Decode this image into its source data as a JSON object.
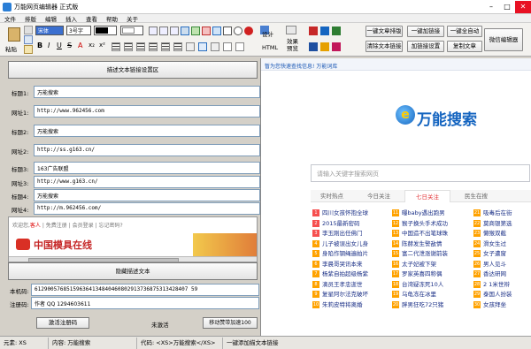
{
  "window": {
    "title": "万能网页编辑器 正式版"
  },
  "menu": [
    "文件",
    "排版",
    "编辑",
    "插入",
    "查看",
    "帮助",
    "关于"
  ],
  "toolbar": {
    "paste": "粘贴",
    "font": "宋体",
    "size": "3号字",
    "design": "设计",
    "html": "HTML",
    "preview_l1": "效果",
    "preview_l2": "预览",
    "cmds": [
      "一键文章排版",
      "一键加链接",
      "一键全自动",
      "清除文本链接",
      "加链接设置",
      "复制文章",
      "微信编辑器"
    ]
  },
  "left": {
    "header_btn": "描述文本链接设置区",
    "rows": [
      {
        "label": "标题1:",
        "value": "万能搜索"
      },
      {
        "label": "网址1:",
        "value": "http://www.962456.com"
      },
      {
        "label": "标题2:",
        "value": "万能搜索"
      },
      {
        "label": "网址2:",
        "value": "http://ss.g163.cn/"
      },
      {
        "label": "标题3:",
        "value": "163广告联盟"
      },
      {
        "label": "网址3:",
        "value": "http://www.g163.cn/"
      },
      {
        "label": "标题4:",
        "value": "万能搜索"
      },
      {
        "label": "网址4:",
        "value": "http://m.962456.com/"
      }
    ],
    "ad_welcome": "欢迎您,",
    "ad_guest": "客人",
    "ad_links": "| 免费注册 | 会员登录 | 忘记密码?",
    "ad_logo": "中国模具在线",
    "hide_btn": "隐藏描述文本",
    "machine_label": "本机码:",
    "machine_value": "612900576851596364134840460802913736875313428407 59",
    "reg_label": "注册码:",
    "reg_value": "作者 QQ 1294603611",
    "activate_btn": "激活注册码",
    "status": "未激活",
    "move_btn": "移动赞带加速100"
  },
  "preview": {
    "url_text": "暂为您快速查找信息! 万能词库",
    "logo_text": "万能搜索",
    "search_placeholder": "请输入关键字搜索网页",
    "tabs": [
      "实时热点",
      "今日关注",
      "七日关注",
      "民生在搜"
    ],
    "hot_left": [
      "四川女孩怀抱全球",
      "2015最新密码",
      "李玉刚出任佛门",
      "儿子被误出女儿身",
      "身陷作钢绳遍拍片",
      "李晨哥哭讯本来",
      "杨紫自拍超级杨紫",
      "滴员王孝忠逝世",
      "复星阿尔法克破坏",
      "朱莉皮特将离婚"
    ],
    "hot_mid": [
      "曝baby遇出跑男",
      "猴子换头手术成功",
      "中国造不出笔球珠",
      "陈赫发生警敌情",
      "富二代泄涨谢前装",
      "太子妃被下架",
      "罗家英喜四称偶",
      "台湾疑冻死10人",
      "乌龟冻在冰里",
      "胖男狂吃72只猪"
    ],
    "hot_right": [
      "吸毒后在街",
      "莫商银第选",
      "懒猴双截",
      "滑女生过",
      "女子遭窗",
      "男人见斗",
      "香达研网",
      "2 1米世辩",
      "泰国人扮装",
      "女孩拜坐"
    ]
  },
  "statusbar": [
    "元素: XS",
    "内容: 万能搜索",
    "代码: <XS>万能搜索</XS>",
    "一键添加描文本链接"
  ]
}
